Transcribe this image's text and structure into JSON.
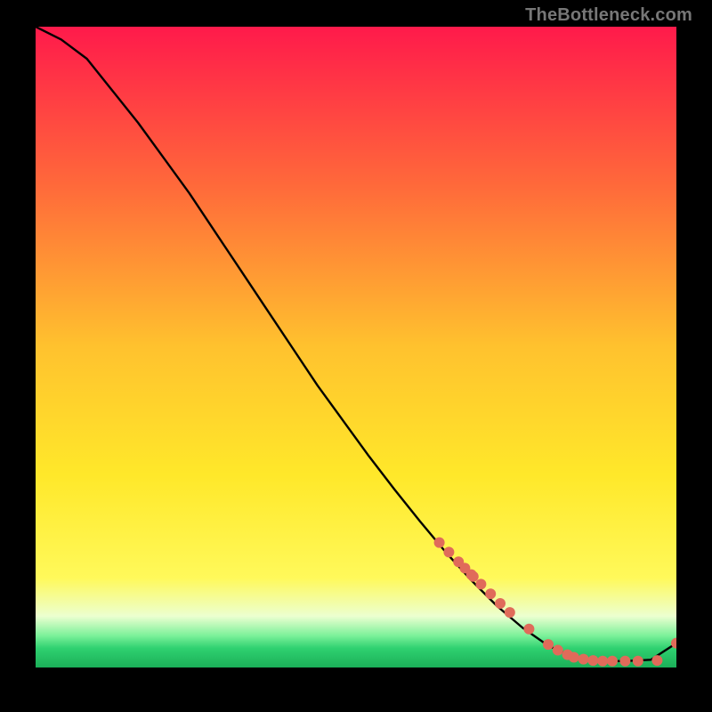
{
  "watermark": "TheBottleneck.com",
  "chart_data": {
    "type": "line",
    "title": "",
    "xlabel": "",
    "ylabel": "",
    "xlim": [
      0,
      100
    ],
    "ylim": [
      0,
      100
    ],
    "grid": false,
    "legend": false,
    "gradient_stops": [
      {
        "offset": 0,
        "color": "#ff1a4b"
      },
      {
        "offset": 0.25,
        "color": "#ff6a3a"
      },
      {
        "offset": 0.5,
        "color": "#ffc22e"
      },
      {
        "offset": 0.7,
        "color": "#ffe82a"
      },
      {
        "offset": 0.86,
        "color": "#fff95a"
      },
      {
        "offset": 0.92,
        "color": "#ecffd0"
      },
      {
        "offset": 0.95,
        "color": "#7df19a"
      },
      {
        "offset": 0.97,
        "color": "#2fd170"
      },
      {
        "offset": 1.0,
        "color": "#1baf58"
      }
    ],
    "series": [
      {
        "name": "curve",
        "x": [
          0,
          4,
          8,
          12,
          16,
          20,
          24,
          28,
          32,
          36,
          40,
          44,
          48,
          52,
          56,
          60,
          64,
          68,
          72,
          76,
          80,
          84,
          88,
          92,
          96,
          100
        ],
        "y": [
          100,
          98,
          95,
          90,
          85,
          79.5,
          74,
          68,
          62,
          56,
          50,
          44,
          38.5,
          33,
          27.8,
          22.8,
          18,
          13.6,
          9.6,
          6.2,
          3.4,
          1.6,
          1.0,
          1.0,
          1.2,
          3.8
        ]
      }
    ],
    "markers": {
      "name": "points",
      "color": "#e06b5a",
      "radius": 6,
      "x": [
        63,
        64.5,
        66,
        67,
        68,
        68.3,
        69.5,
        71,
        72.5,
        74,
        77,
        80,
        81.5,
        83,
        84,
        85.5,
        87,
        88.5,
        90,
        92,
        94,
        97,
        100
      ],
      "y": [
        19.5,
        18.0,
        16.5,
        15.5,
        14.5,
        14.2,
        13.0,
        11.5,
        10.0,
        8.6,
        6.0,
        3.6,
        2.7,
        2.0,
        1.6,
        1.3,
        1.1,
        1.0,
        1.0,
        1.0,
        1.0,
        1.1,
        3.8
      ]
    }
  }
}
